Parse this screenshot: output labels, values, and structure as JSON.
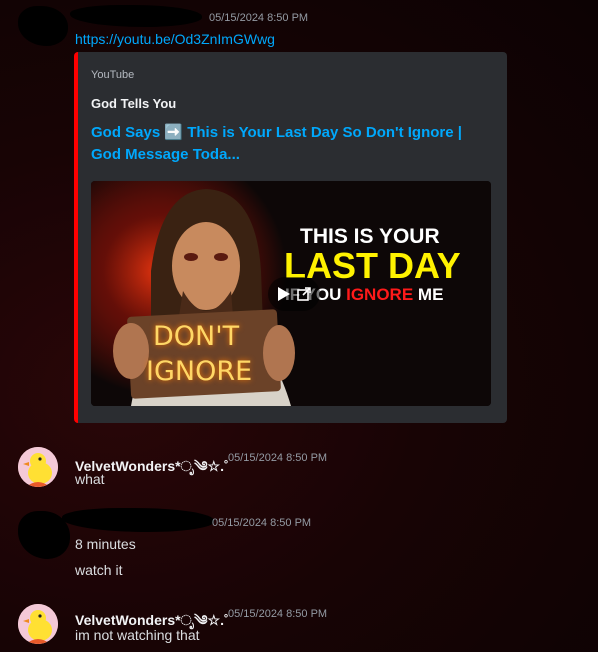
{
  "messages": [
    {
      "author": "",
      "timestamp": "05/15/2024 8:50 PM",
      "link": "https://youtu.be/Od3ZnImGWwg"
    },
    {
      "author": "VelvetWonders*ೃ༄☆.˚",
      "timestamp": "05/15/2024 8:50 PM",
      "text": "what"
    },
    {
      "author": "",
      "timestamp": "05/15/2024 8:50 PM",
      "lines": [
        "8 minutes",
        "watch it"
      ]
    },
    {
      "author": "VelvetWonders*ೃ༄☆.˚",
      "timestamp": "05/15/2024 8:50 PM",
      "text": "im not watching that"
    }
  ],
  "embed": {
    "provider": "YouTube",
    "author": "God Tells You",
    "title": "God Says ➡️ This is Your Last Day So Don't Ignore | God Message Toda...",
    "accent_color": "#ff0000",
    "thumbnail": {
      "line1": "THIS IS YOUR",
      "line2": "LAST DAY",
      "line3_a": "IF YOU",
      "line3_b": "IGNORE",
      "line3_c": "ME",
      "sign_1": "DON'T",
      "sign_2": "IGNORE"
    }
  },
  "icons": [
    "play-icon",
    "popout-icon"
  ]
}
